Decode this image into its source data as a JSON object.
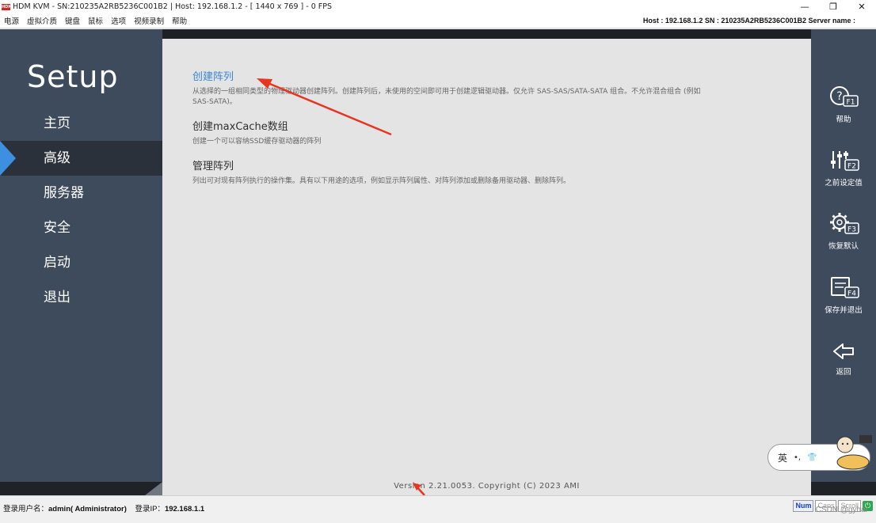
{
  "window": {
    "app_icon_text": "HDM",
    "title": "HDM KVM - SN:210235A2RB5236C001B2 | Host: 192.168.1.2 - [ 1440 x 769 ] - 0 FPS",
    "minimize": "—",
    "restore": "❐",
    "close": "✕"
  },
  "menubar": {
    "items": [
      "电源",
      "虚拟介质",
      "键盘",
      "鼠标",
      "选项",
      "视频录制",
      "帮助"
    ],
    "host_info": "Host : 192.168.1.2   SN : 210235A2RB5236C001B2   Server name :"
  },
  "bios": {
    "setup_title": "Setup",
    "nav": [
      {
        "label": "主页",
        "active": false
      },
      {
        "label": "高级",
        "active": true
      },
      {
        "label": "服务器",
        "active": false
      },
      {
        "label": "安全",
        "active": false
      },
      {
        "label": "启动",
        "active": false
      },
      {
        "label": "退出",
        "active": false
      }
    ],
    "entries": [
      {
        "title": "创建阵列",
        "desc": "从选择的一组相同类型的物理驱动器创建阵列。创建阵列后，未使用的空间即可用于创建逻辑驱动器。仅允许 SAS-SAS/SATA-SATA 组合。不允许混合组合 (例如 SAS-SATA)。"
      },
      {
        "title": "创建maxCache数组",
        "desc": "创建一个可以容纳SSD缓存驱动器的阵列"
      },
      {
        "title": "管理阵列",
        "desc": "列出可对现有阵列执行的操作集。具有以下用途的选项，例如显示阵列属性、对阵列添加或删除备用驱动器、删除阵列。"
      }
    ],
    "version": "Version 2.21.0053. Copyright (C) 2023 AMI",
    "fkeys": [
      {
        "key": "F1",
        "label": "帮助",
        "icon": "help-icon"
      },
      {
        "key": "F2",
        "label": "之前设定值",
        "icon": "sliders-icon"
      },
      {
        "key": "F3",
        "label": "恢复默认",
        "icon": "gear-icon"
      },
      {
        "key": "F4",
        "label": "保存并退出",
        "icon": "save-icon"
      },
      {
        "key": "",
        "label": "返回",
        "icon": "back-arrow-icon"
      }
    ]
  },
  "ime": {
    "lang": "英",
    "punct": "•,",
    "shirt": "👕"
  },
  "statusbar": {
    "login_user_label": "登录用户名：",
    "login_user": "admin( Administrator)",
    "login_ip_label": "登录IP：",
    "login_ip": "192.168.1.1",
    "num": "Num",
    "caps": "Caps",
    "scroll": "Scroll",
    "watermark": "CSDN @gyhar"
  },
  "colors": {
    "bios_panel": "#3e4b5d",
    "content_bg": "#e4e4e4",
    "link_blue": "#3a86d6",
    "active_marker": "#3d8fe0",
    "annotation_red": "#e8351f"
  }
}
